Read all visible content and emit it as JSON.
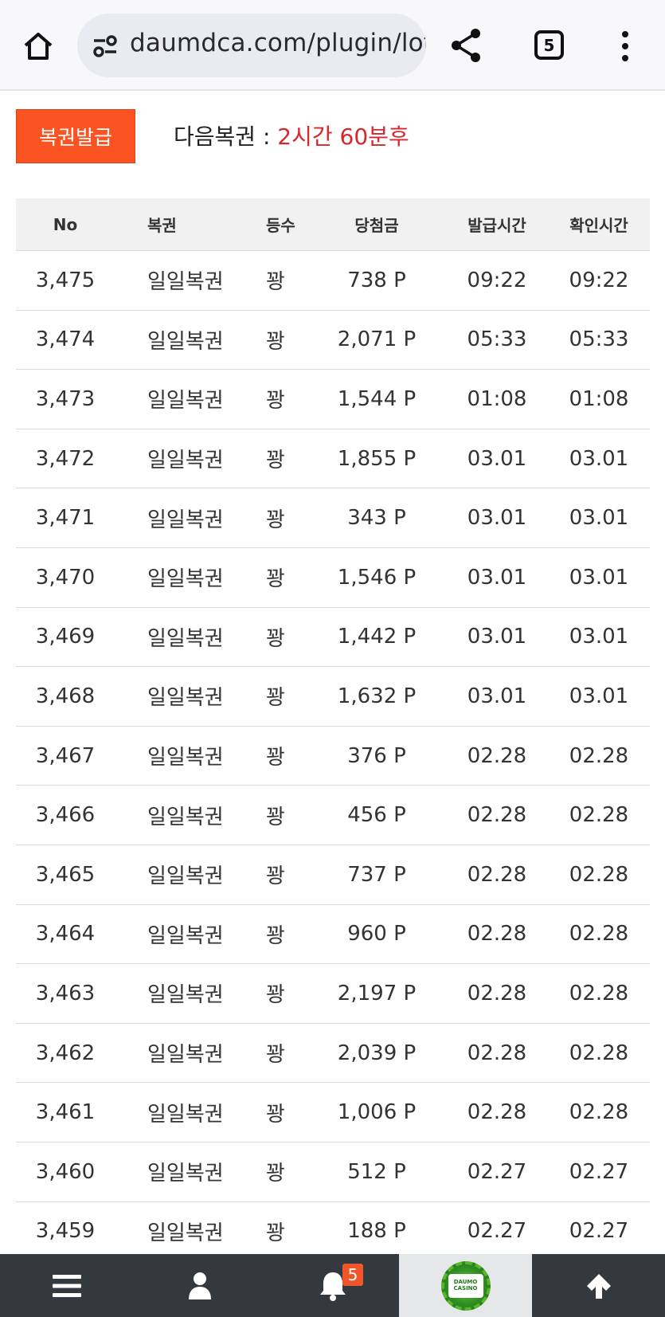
{
  "browser": {
    "url": "daumdca.com/plugin/lot",
    "tab_count": "5"
  },
  "lottery": {
    "issue_button": "복권발급",
    "next_label": "다음복권 : ",
    "next_value": "2시간 60분후"
  },
  "table": {
    "headers": [
      "No",
      "복권",
      "등수",
      "당첨금",
      "발급시간",
      "확인시간"
    ],
    "rows": [
      [
        "3,475",
        "일일복권",
        "꽝",
        "738 P",
        "09:22",
        "09:22"
      ],
      [
        "3,474",
        "일일복권",
        "꽝",
        "2,071 P",
        "05:33",
        "05:33"
      ],
      [
        "3,473",
        "일일복권",
        "꽝",
        "1,544 P",
        "01:08",
        "01:08"
      ],
      [
        "3,472",
        "일일복권",
        "꽝",
        "1,855 P",
        "03.01",
        "03.01"
      ],
      [
        "3,471",
        "일일복권",
        "꽝",
        "343 P",
        "03.01",
        "03.01"
      ],
      [
        "3,470",
        "일일복권",
        "꽝",
        "1,546 P",
        "03.01",
        "03.01"
      ],
      [
        "3,469",
        "일일복권",
        "꽝",
        "1,442 P",
        "03.01",
        "03.01"
      ],
      [
        "3,468",
        "일일복권",
        "꽝",
        "1,632 P",
        "03.01",
        "03.01"
      ],
      [
        "3,467",
        "일일복권",
        "꽝",
        "376 P",
        "02.28",
        "02.28"
      ],
      [
        "3,466",
        "일일복권",
        "꽝",
        "456 P",
        "02.28",
        "02.28"
      ],
      [
        "3,465",
        "일일복권",
        "꽝",
        "737 P",
        "02.28",
        "02.28"
      ],
      [
        "3,464",
        "일일복권",
        "꽝",
        "960 P",
        "02.28",
        "02.28"
      ],
      [
        "3,463",
        "일일복권",
        "꽝",
        "2,197 P",
        "02.28",
        "02.28"
      ],
      [
        "3,462",
        "일일복권",
        "꽝",
        "2,039 P",
        "02.28",
        "02.28"
      ],
      [
        "3,461",
        "일일복권",
        "꽝",
        "1,006 P",
        "02.28",
        "02.28"
      ],
      [
        "3,460",
        "일일복권",
        "꽝",
        "512 P",
        "02.27",
        "02.27"
      ],
      [
        "3,459",
        "일일복권",
        "꽝",
        "188 P",
        "02.27",
        "02.27"
      ]
    ]
  },
  "bottom_nav": {
    "notification_count": "5",
    "logo_top": "DAUMO",
    "logo_bottom": "CASINO",
    "items": [
      "menu-icon",
      "user-icon",
      "bell-icon",
      "casino-logo",
      "arrow-up-icon"
    ]
  },
  "colors": {
    "issue_button": "#fb5422",
    "next_value": "#d7262d",
    "nav_background": "#34383f"
  }
}
